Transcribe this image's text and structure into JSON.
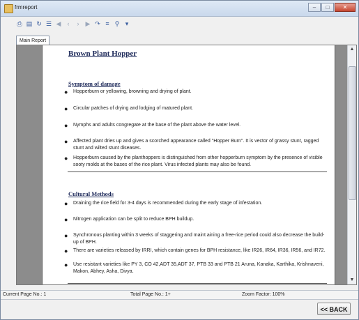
{
  "window": {
    "title": "frmreport"
  },
  "toolbar": {
    "icons": [
      "print-icon",
      "page-setup-icon",
      "refresh-icon",
      "tree-toggle-icon",
      "first-page-icon",
      "prev-page-icon",
      "next-page-icon",
      "last-page-icon",
      "goto-page-icon",
      "export-icon",
      "search-icon",
      "zoom-icon"
    ]
  },
  "tab": {
    "label": "Main Report"
  },
  "report": {
    "title": "Brown Plant Hopper",
    "sections": [
      {
        "heading": "Symptom of damage",
        "bullets": [
          "Hopperburn or yellowing, browning and drying of plant.",
          "Circular patches of drying and lodging of matured plant.",
          "Nymphs and adults congregate at the base of the plant above the water level.",
          "Affected plant dries up and gives a scorched appearance called \"Hopper Burn\". It is vector of grassy stunt, ragged stunt and wilted stunt diseases.",
          "Hopperburn caused by the planthoppers is distinguished from other hopperburn symptom by the presence of visible sooty molds at the bases of the rice plant. Virus infected plants may also be found."
        ]
      },
      {
        "heading": "Cultural Methods",
        "bullets": [
          "Draining the rice field for 3-4 days is recommended during the early stage of infestation.",
          "Nitrogen application can be split to reduce BPH buildup.",
          "Synchronous planting within 3 weeks of staggering and maint aining a free-rice period could also decrease the build-up of BPH.",
          "There are varieties released by IRRI, which contain genes for BPH resistance, like IR26, IR64, IR36, IR56, and IR72.",
          "Use resistant varieties like PY 3, CO 42,ADT 35,ADT 37, PTB 33 and PTB 21  Aruna, Kanaka, Karthika, Krishnaveni, Makon, Abhey, Asha, Divya."
        ]
      }
    ]
  },
  "status": {
    "current_page": "Current Page No.: 1",
    "total_page": "Total Page No.: 1+",
    "zoom": "Zoom Factor: 100%"
  },
  "back_button": {
    "label": "<< BACK"
  }
}
